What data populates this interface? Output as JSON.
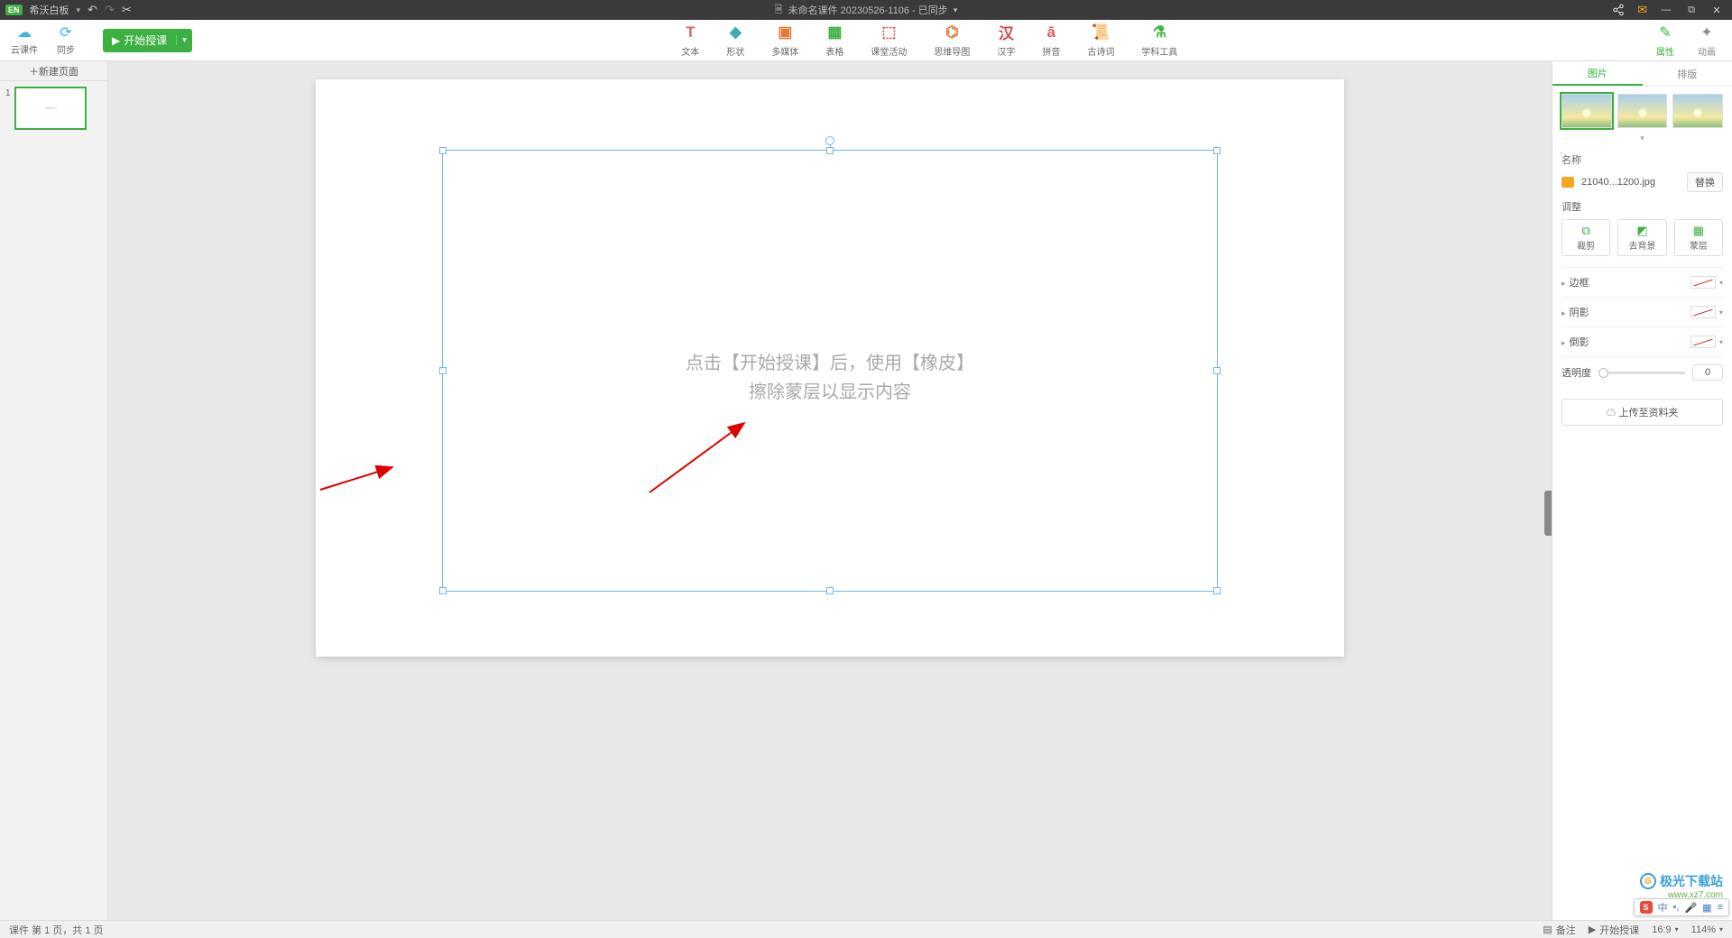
{
  "titlebar": {
    "badge": "EN",
    "app": "希沃白板",
    "doc_prefix": "未命名课件 20230526-1106 - 已同步"
  },
  "toolbar_left": {
    "cloud": "云课件",
    "sync": "同步",
    "start": "开始授课"
  },
  "toolbar_center": [
    {
      "label": "文本",
      "color": "#d66"
    },
    {
      "label": "形状",
      "color": "#4aa"
    },
    {
      "label": "多媒体",
      "color": "#e07b3a"
    },
    {
      "label": "表格",
      "color": "#3cb043"
    },
    {
      "label": "课堂活动",
      "color": "#e05a5a"
    },
    {
      "label": "思维导图",
      "color": "#e07b3a"
    },
    {
      "label": "汉字",
      "color": "#d04848"
    },
    {
      "label": "拼音",
      "color": "#e05a5a"
    },
    {
      "label": "古诗词",
      "color": "#b88a4a"
    },
    {
      "label": "学科工具",
      "color": "#3cb043"
    }
  ],
  "toolbar_right": {
    "props": "属性",
    "anim": "动画"
  },
  "left": {
    "new_page": "新建页面",
    "thumb_text": "（缩略图内容）"
  },
  "canvas": {
    "hint1": "点击【开始授课】后，使用【橡皮】",
    "hint2": "擦除蒙层以显示内容"
  },
  "right": {
    "tab_image": "图片",
    "tab_layout": "排版",
    "section_name": "名称",
    "filename": "21040...1200.jpg",
    "replace": "替换",
    "section_adjust": "调整",
    "crop": "裁剪",
    "removebg": "去背景",
    "mask": "蒙层",
    "border": "边框",
    "shadow": "阴影",
    "reflection": "倒影",
    "opacity_label": "透明度",
    "opacity_value": "0",
    "upload": "上传至资料夹"
  },
  "ime": {
    "zh": "中",
    "grid": "▦"
  },
  "watermark": {
    "text": "极光下载站",
    "url": "www.xz7.com"
  },
  "status": {
    "left": "课件 第 1 页，共 1 页",
    "note": "备注",
    "start": "开始授课",
    "ratio": "16:9",
    "zoom": "114%"
  }
}
